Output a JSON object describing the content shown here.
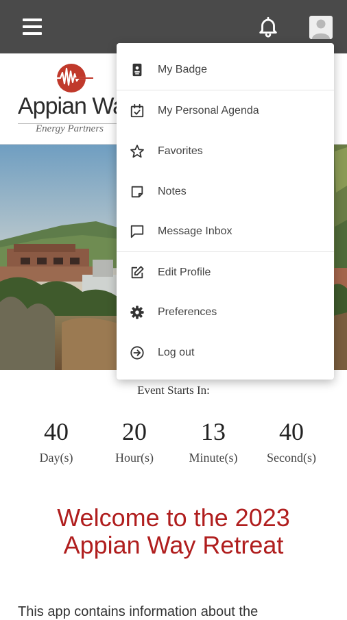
{
  "header": {
    "menu_icon": "hamburger-menu-icon",
    "notifications_icon": "bell-icon",
    "profile_icon": "user-avatar-icon"
  },
  "logo": {
    "name": "Appian Way",
    "tagline": "Energy Partners",
    "brand_color": "#c0392b"
  },
  "menu": {
    "items": [
      {
        "label": "My Badge",
        "icon": "badge-icon"
      },
      {
        "label": "My Personal Agenda",
        "icon": "calendar-check-icon"
      },
      {
        "label": "Favorites",
        "icon": "star-icon"
      },
      {
        "label": "Notes",
        "icon": "note-icon"
      },
      {
        "label": "Message Inbox",
        "icon": "message-icon"
      },
      {
        "label": "Edit Profile",
        "icon": "edit-icon"
      },
      {
        "label": "Preferences",
        "icon": "gear-icon"
      },
      {
        "label": "Log out",
        "icon": "logout-icon"
      }
    ]
  },
  "countdown": {
    "title": "Event Starts In:",
    "days": {
      "value": "40",
      "unit": "Day(s)"
    },
    "hours": {
      "value": "20",
      "unit": "Hour(s)"
    },
    "minutes": {
      "value": "13",
      "unit": "Minute(s)"
    },
    "seconds": {
      "value": "40",
      "unit": "Second(s)"
    }
  },
  "welcome": {
    "line1": "Welcome to the 2023",
    "line2": "Appian Way Retreat",
    "color": "#b01e1e"
  },
  "intro_text": "This app contains information about the"
}
